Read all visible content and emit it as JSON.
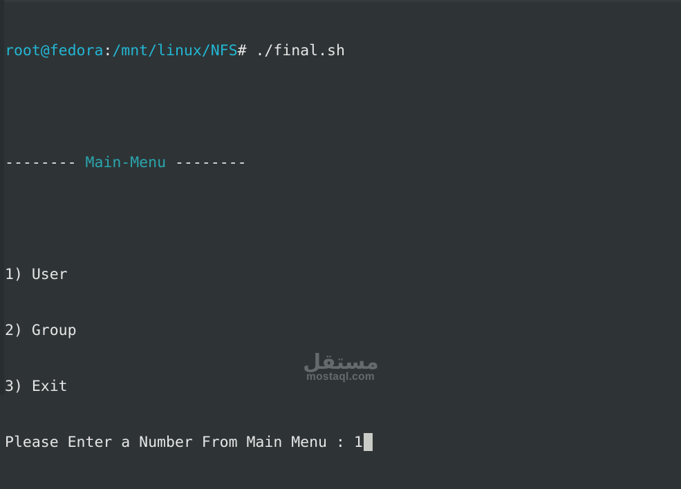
{
  "terminal": {
    "prompt": {
      "user_host": "root@fedora",
      "separator": ":",
      "path": "/mnt/linux/NFS",
      "symbol": "#",
      "command": " ./final.sh"
    },
    "menu_header": {
      "left_dashes": "--------",
      "title": "Main-Menu",
      "right_dashes": "--------"
    },
    "options": [
      {
        "number": "1)",
        "label": "User"
      },
      {
        "number": "2)",
        "label": "Group"
      },
      {
        "number": "3)",
        "label": "Exit"
      }
    ],
    "input_prompt": "Please Enter a Number From Main Menu : ",
    "input_value": "1"
  },
  "watermark": {
    "arabic_logo": "مستقل",
    "site": "mostaql.com"
  },
  "colors": {
    "background": "#2e3436",
    "foreground": "#e6e6e6",
    "prompt_cyan": "#23b6d4",
    "menu_title": "#2aa6ae",
    "cursor": "#c9ccc6"
  }
}
